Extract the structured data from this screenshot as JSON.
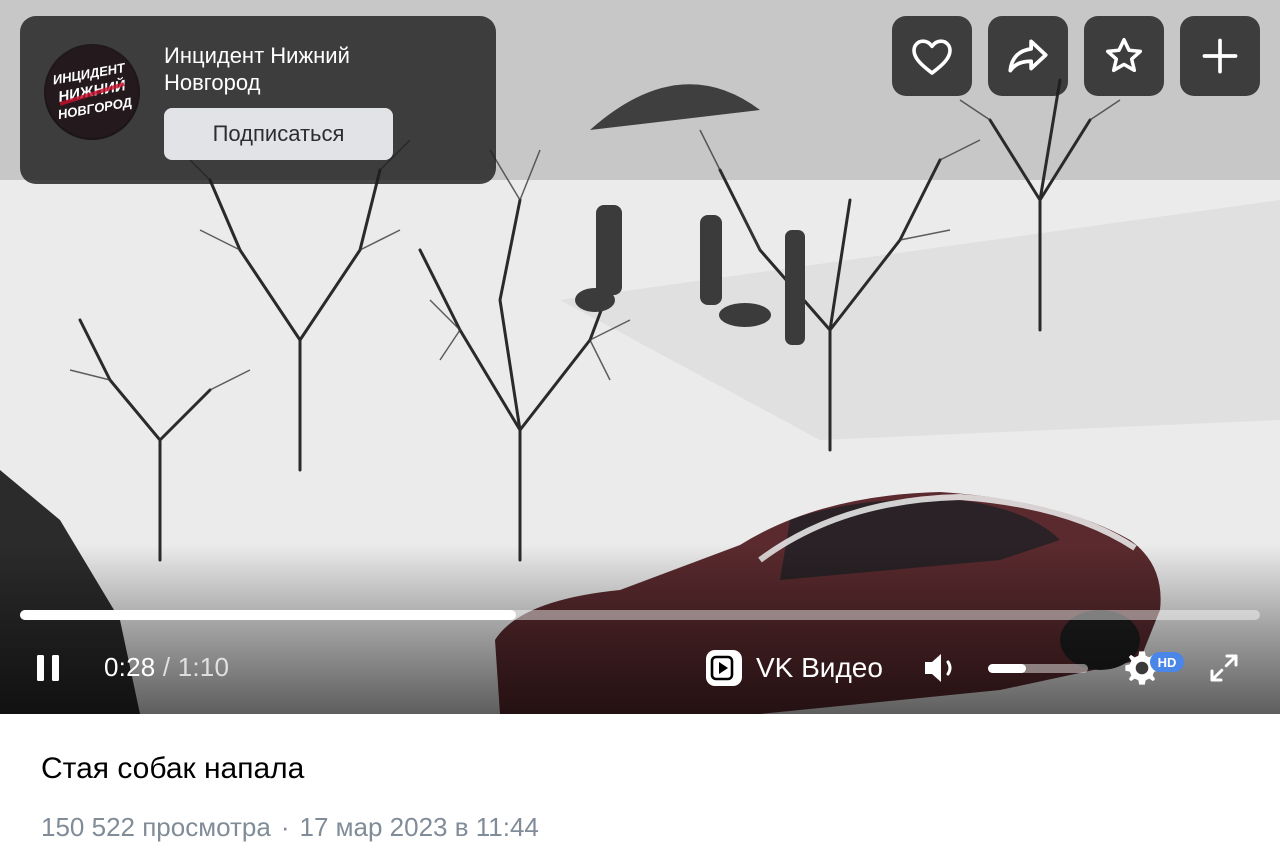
{
  "channel": {
    "name_line1": "Инцидент Нижний",
    "name_line2": "Новгород",
    "logo_text": [
      "ИНЦИДЕНТ",
      "НИЖНИЙ",
      "НОВГОРОД"
    ],
    "subscribe_label": "Подписаться"
  },
  "actions": [
    {
      "name": "like-button",
      "icon": "heart-icon"
    },
    {
      "name": "share-button",
      "icon": "share-arrow-icon"
    },
    {
      "name": "favorite-button",
      "icon": "star-icon"
    },
    {
      "name": "add-button",
      "icon": "plus-icon"
    }
  ],
  "player": {
    "current_time": "0:28",
    "separator": "/",
    "duration": "1:10",
    "progress_fraction": 0.4,
    "brand": "VK Видео",
    "volume_fraction": 0.38,
    "quality_badge": "HD"
  },
  "video": {
    "title": "Стая собак напала",
    "views": "150 522 просмотра",
    "meta_separator": "·",
    "date": "17 мар 2023 в 11:44"
  },
  "colors": {
    "accent_badge": "#4a86e8",
    "meta_text": "#818c99",
    "overlay_panel": "#1e1e1e"
  }
}
